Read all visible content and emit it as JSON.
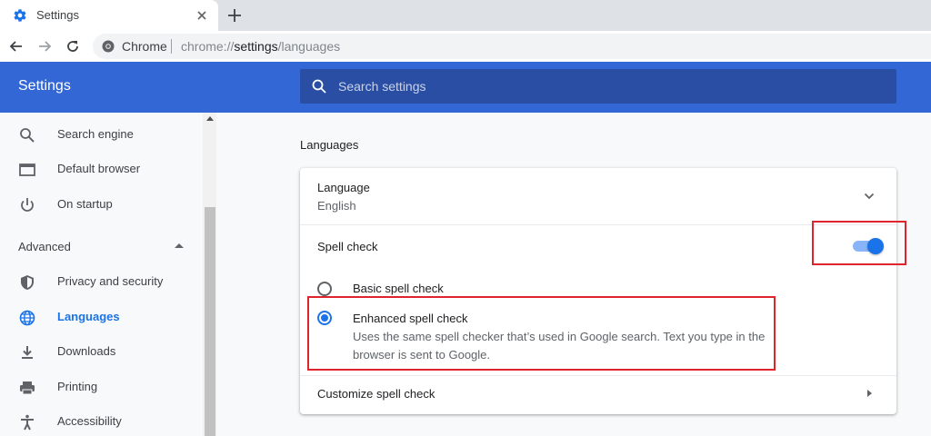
{
  "browser": {
    "tab_title": "Settings",
    "omnibox_site": "Chrome",
    "url_scheme": "chrome://",
    "url_host": "settings",
    "url_path": "/languages"
  },
  "header": {
    "title": "Settings",
    "search_placeholder": "Search settings"
  },
  "sidebar": {
    "items_top": [
      {
        "label": "Search engine",
        "icon": "search-icon"
      },
      {
        "label": "Default browser",
        "icon": "browser-window-icon"
      },
      {
        "label": "On startup",
        "icon": "power-icon"
      }
    ],
    "section_label": "Advanced",
    "items_advanced": [
      {
        "label": "Privacy and security",
        "icon": "shield-icon"
      },
      {
        "label": "Languages",
        "icon": "globe-icon",
        "active": true
      },
      {
        "label": "Downloads",
        "icon": "download-icon"
      },
      {
        "label": "Printing",
        "icon": "printer-icon"
      },
      {
        "label": "Accessibility",
        "icon": "accessibility-icon"
      }
    ]
  },
  "main": {
    "section_title": "Languages",
    "language_row": {
      "title": "Language",
      "value": "English"
    },
    "spell_check": {
      "label": "Spell check",
      "enabled": true
    },
    "options": {
      "basic": {
        "label": "Basic spell check",
        "checked": false
      },
      "enhanced": {
        "label": "Enhanced spell check",
        "description": "Uses the same spell checker that’s used in Google search. Text you type in the browser is sent to Google.",
        "checked": true
      }
    },
    "customize_label": "Customize spell check"
  },
  "colors": {
    "accent": "#1a73e8",
    "header_bg": "#3367d6",
    "highlight": "#e0242e"
  }
}
